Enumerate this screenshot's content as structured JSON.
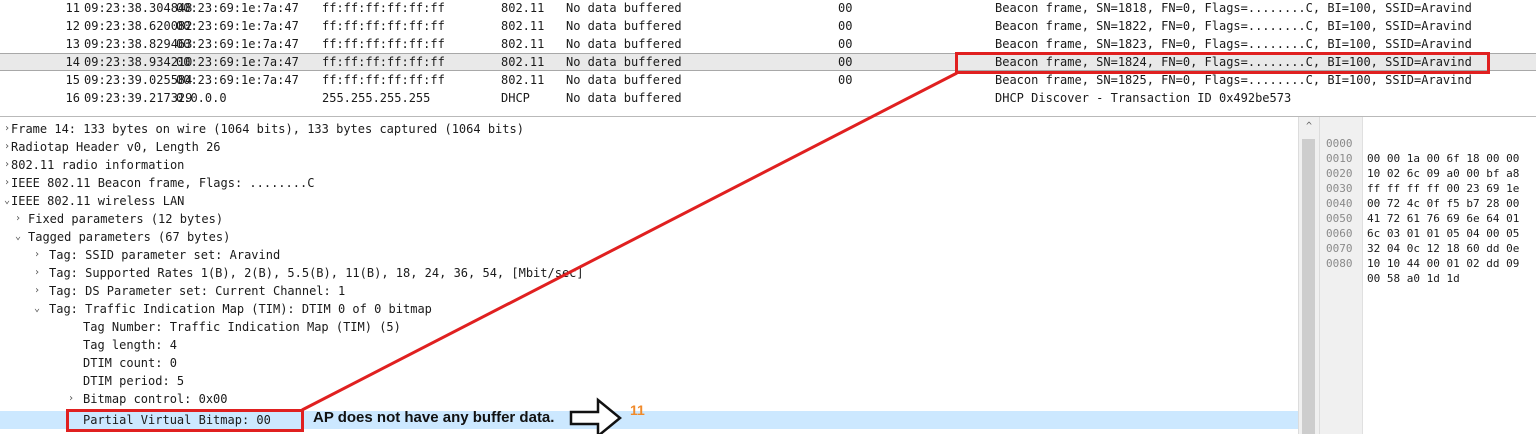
{
  "packet_list": {
    "rows": [
      {
        "no": "11",
        "time": "09:23:38.304848",
        "src": "00:23:69:1e:7a:47",
        "dst": "ff:ff:ff:ff:ff:ff",
        "proto": "802.11",
        "buf": "No data buffered",
        "val": "00",
        "info": "Beacon frame, SN=1818, FN=0, Flags=........C, BI=100, SSID=Aravind"
      },
      {
        "no": "12",
        "time": "09:23:38.620082",
        "src": "00:23:69:1e:7a:47",
        "dst": "ff:ff:ff:ff:ff:ff",
        "proto": "802.11",
        "buf": "No data buffered",
        "val": "00",
        "info": "Beacon frame, SN=1822, FN=0, Flags=........C, BI=100, SSID=Aravind"
      },
      {
        "no": "13",
        "time": "09:23:38.829463",
        "src": "00:23:69:1e:7a:47",
        "dst": "ff:ff:ff:ff:ff:ff",
        "proto": "802.11",
        "buf": "No data buffered",
        "val": "00",
        "info": "Beacon frame, SN=1823, FN=0, Flags=........C, BI=100, SSID=Aravind"
      },
      {
        "no": "14",
        "time": "09:23:38.934210",
        "src": "00:23:69:1e:7a:47",
        "dst": "ff:ff:ff:ff:ff:ff",
        "proto": "802.11",
        "buf": "No data buffered",
        "val": "00",
        "info": "Beacon frame, SN=1824, FN=0, Flags=........C, BI=100, SSID=Aravind"
      },
      {
        "no": "15",
        "time": "09:23:39.025584",
        "src": "00:23:69:1e:7a:47",
        "dst": "ff:ff:ff:ff:ff:ff",
        "proto": "802.11",
        "buf": "No data buffered",
        "val": "00",
        "info": "Beacon frame, SN=1825, FN=0, Flags=........C, BI=100, SSID=Aravind"
      },
      {
        "no": "16",
        "time": "09:23:39.217329",
        "src": "0.0.0.0",
        "dst": "255.255.255.255",
        "proto": "DHCP",
        "buf": "No data buffered",
        "val": "",
        "info": "DHCP Discover - Transaction ID 0x492be573"
      }
    ]
  },
  "detail": {
    "rows": [
      {
        "arrow": "›",
        "text": "Frame 14: 133 bytes on wire (1064 bits), 133 bytes captured (1064 bits)"
      },
      {
        "arrow": "›",
        "text": "Radiotap Header v0, Length 26"
      },
      {
        "arrow": "›",
        "text": "802.11 radio information"
      },
      {
        "arrow": "›",
        "text": "IEEE 802.11 Beacon frame, Flags: ........C"
      },
      {
        "arrow": "⌄",
        "text": "IEEE 802.11 wireless LAN"
      },
      {
        "arrow": "›",
        "text": "Fixed parameters (12 bytes)"
      },
      {
        "arrow": "⌄",
        "text": "Tagged parameters (67 bytes)"
      },
      {
        "arrow": "›",
        "text": "Tag: SSID parameter set: Aravind"
      },
      {
        "arrow": "›",
        "text": "Tag: Supported Rates 1(B), 2(B), 5.5(B), 11(B), 18, 24, 36, 54, [Mbit/sec]"
      },
      {
        "arrow": "›",
        "text": "Tag: DS Parameter set: Current Channel: 1"
      },
      {
        "arrow": "⌄",
        "text": "Tag: Traffic Indication Map (TIM): DTIM 0 of 0 bitmap"
      },
      {
        "arrow": "",
        "text": "Tag Number: Traffic Indication Map (TIM) (5)"
      },
      {
        "arrow": "",
        "text": "Tag length: 4"
      },
      {
        "arrow": "",
        "text": "DTIM count: 0"
      },
      {
        "arrow": "",
        "text": "DTIM period: 5"
      },
      {
        "arrow": "›",
        "text": "Bitmap control: 0x00"
      },
      {
        "arrow": "",
        "text": "Partial Virtual Bitmap: 00"
      }
    ]
  },
  "hex": {
    "rows": [
      {
        "off": "0000",
        "bytes": "00 00 1a 00 6f 18 00 00"
      },
      {
        "off": "0010",
        "bytes": "10 02 6c 09 a0 00 bf a8"
      },
      {
        "off": "0020",
        "bytes": "ff ff ff ff 00 23 69 1e"
      },
      {
        "off": "0030",
        "bytes": "00 72 4c 0f f5 b7 28 00"
      },
      {
        "off": "0040",
        "bytes": "41 72 61 76 69 6e 64 01"
      },
      {
        "off": "0050",
        "bytes": "6c 03 01 01 05 04 00 05"
      },
      {
        "off": "0060",
        "bytes": "32 04 0c 12 18 60 dd 0e"
      },
      {
        "off": "0070",
        "bytes": "10 10 44 00 01 02 dd 09"
      },
      {
        "off": "0080",
        "bytes": "00 58 a0 1d 1d"
      }
    ]
  },
  "annotation": {
    "note": "AP does not have any buffer data.",
    "step": "11",
    "color": "#e02020"
  },
  "icons": {
    "collapsed": "chevron-right-icon",
    "expanded": "chevron-down-icon",
    "callout": "arrow-right-outline-icon"
  }
}
